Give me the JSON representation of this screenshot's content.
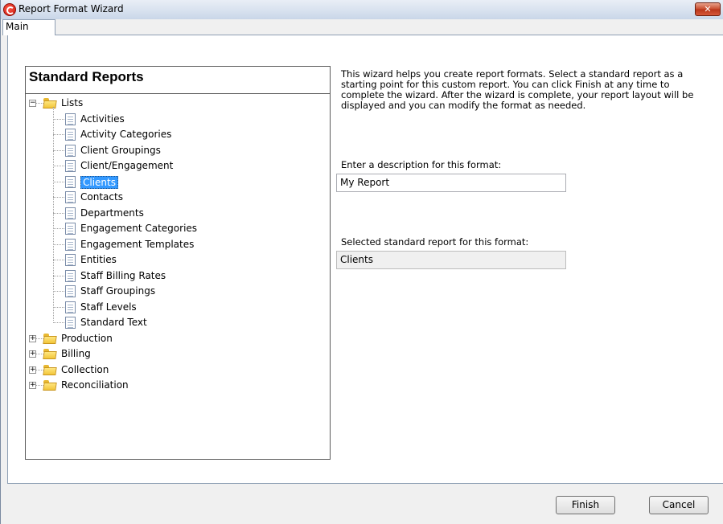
{
  "window": {
    "title": "Report Format Wizard",
    "close_glyph": "✕"
  },
  "tabs": [
    {
      "label": "Main"
    }
  ],
  "reports": {
    "title": "Standard Reports",
    "tree": [
      {
        "label": "Lists",
        "expanded": true,
        "expander": "−",
        "children": [
          "Activities",
          "Activity Categories",
          "Client Groupings",
          "Client/Engagement",
          "Clients",
          "Contacts",
          "Departments",
          "Engagement Categories",
          "Engagement Templates",
          "Entities",
          "Staff Billing Rates",
          "Staff Groupings",
          "Staff Levels",
          "Standard Text"
        ],
        "selected": "Clients"
      },
      {
        "label": "Production",
        "expanded": false,
        "expander": "+"
      },
      {
        "label": "Billing",
        "expanded": false,
        "expander": "+"
      },
      {
        "label": "Collection",
        "expanded": false,
        "expander": "+"
      },
      {
        "label": "Reconciliation",
        "expanded": false,
        "expander": "+"
      }
    ]
  },
  "intro_text": "This wizard helps you create report formats.  Select a standard report as a starting point for this custom report.  You can click Finish at any time to complete the wizard.  After the wizard is complete, your report layout will be displayed and you can modify the format as needed.",
  "description": {
    "label": "Enter a description for this format:",
    "value": "My Report"
  },
  "selected_report": {
    "label": "Selected standard report for this format:",
    "value": "Clients"
  },
  "buttons": {
    "finish": "Finish",
    "cancel": "Cancel"
  },
  "colors": {
    "selection": "#3399ff",
    "close": "#c74a2c"
  }
}
